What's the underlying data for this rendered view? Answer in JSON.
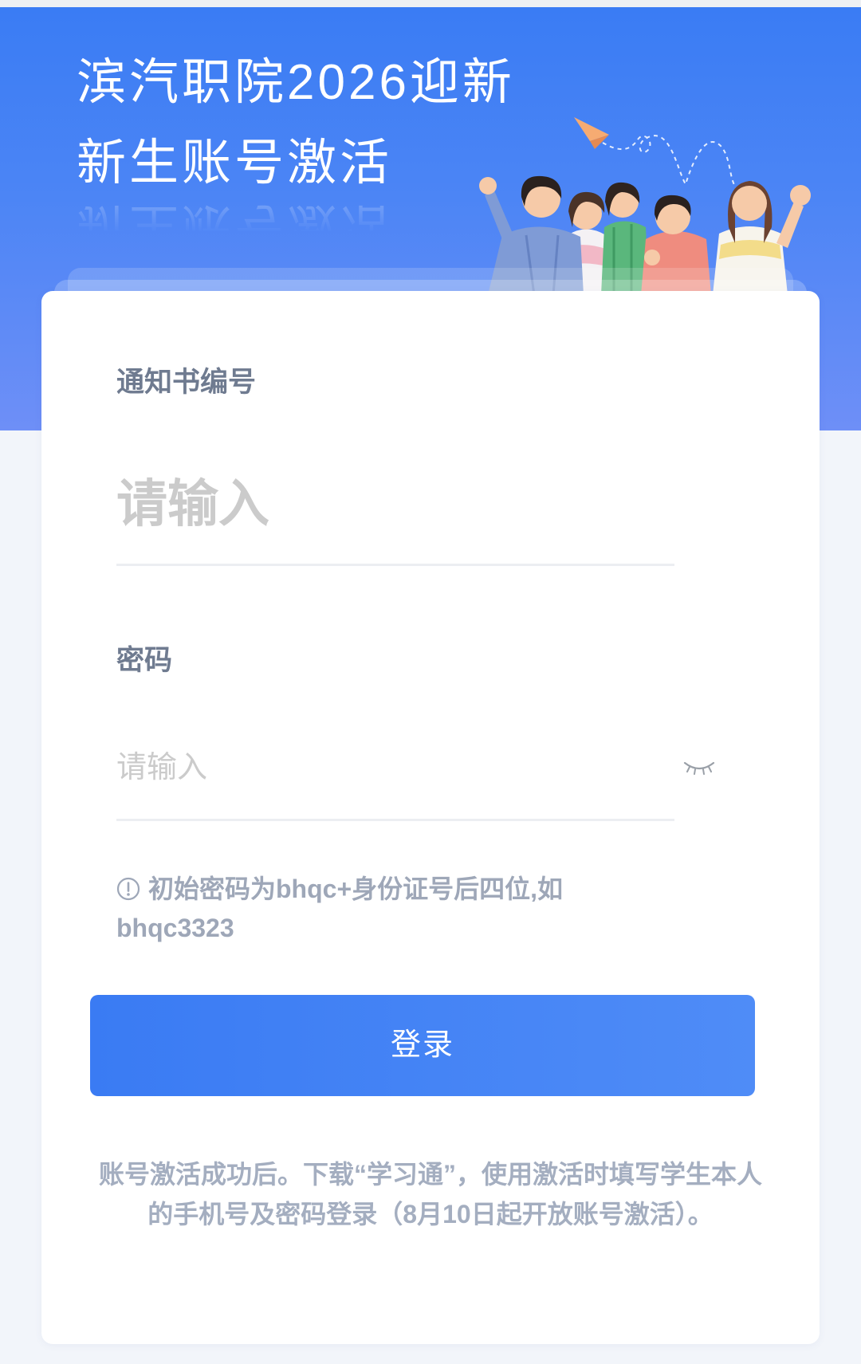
{
  "header": {
    "title_line1": "滨汽职院2026迎新",
    "title_line2": "新生账号激活",
    "illustration_icon": "students-illustration"
  },
  "form": {
    "notice_label": "通知书编号",
    "notice_placeholder": "请输入",
    "password_label": "密码",
    "password_placeholder": "请输入",
    "password_toggle_icon": "eye-closed-icon",
    "hint_icon": "info-icon",
    "hint_text": "初始密码为bhqc+身份证号后四位,如bhqc3323",
    "login_label": "登录"
  },
  "footer": {
    "note": "账号激活成功后。下载“学习通”，使用激活时填写学生本人的手机号及密码登录（8月10日起开放账号激活）。"
  },
  "colors": {
    "header_top": "#3a7cf4",
    "header_bottom": "#6e8ff7",
    "button": "#3a7bf3",
    "label": "#6f7b90",
    "hint": "#9ea7b8",
    "placeholder": "#cbcbcb",
    "page_bg": "#f2f5fa"
  }
}
